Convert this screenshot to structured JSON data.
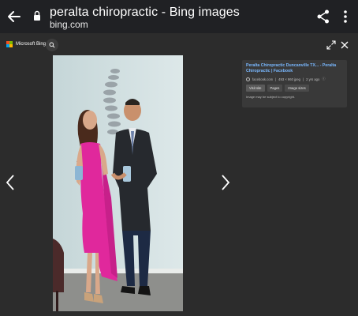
{
  "browser": {
    "title": "peralta chiropractic - Bing images",
    "domain": "bing.com"
  },
  "viewer": {
    "brand": "Microsoft Bing",
    "brand_colors": [
      "#f25022",
      "#7fba00",
      "#00a4ef",
      "#ffb900"
    ]
  },
  "panel": {
    "title": "Peralta Chiropractic Duncanville TX... - Peralta Chiropractic | Facebook",
    "source": "facebook.com",
    "dimensions": "493 × 960 jpeg",
    "age": "2 yrs ago",
    "buttons": [
      "Visit site",
      "Pages",
      "Image sizes"
    ],
    "note": "Image may be subject to copyright."
  },
  "icons": {
    "back": "arrow-left-icon",
    "lock": "lock-icon",
    "share": "share-icon",
    "menu": "more-vert-icon",
    "search": "search-icon",
    "expand": "expand-icon",
    "close": "close-icon",
    "prev": "chevron-left-icon",
    "next": "chevron-right-icon"
  }
}
